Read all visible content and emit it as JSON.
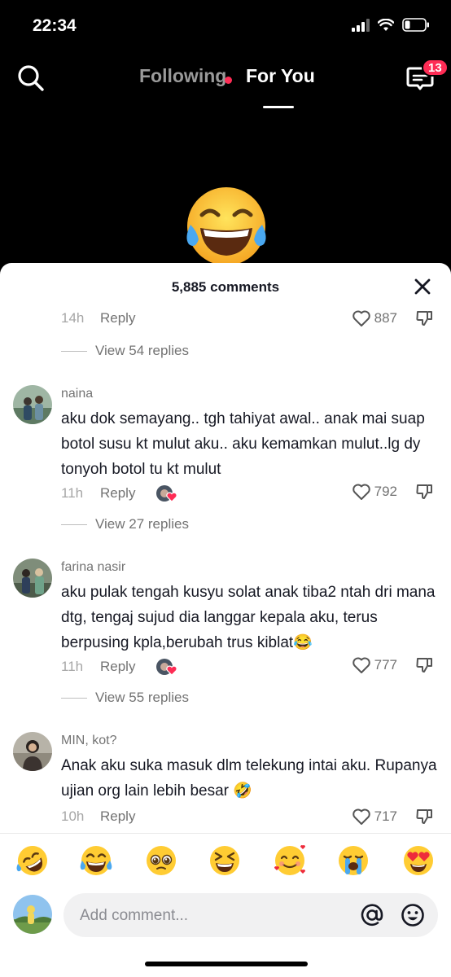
{
  "status_bar": {
    "time": "22:34"
  },
  "nav": {
    "tab_following": "Following",
    "tab_for_you": "For You",
    "inbox_badge": "13"
  },
  "comments_sheet": {
    "title": "5,885 comments",
    "comments": [
      {
        "username": "",
        "text": "",
        "time": "14h",
        "reply_label": "Reply",
        "likes": "887",
        "view_replies": "View 54 replies"
      },
      {
        "username": "naina",
        "text": "aku dok semayang.. tgh tahiyat awal.. anak mai suap botol susu kt mulut aku.. aku kemamkan mulut..lg dy tonyoh botol tu kt mulut",
        "time": "11h",
        "reply_label": "Reply",
        "likes": "792",
        "view_replies": "View 27 replies"
      },
      {
        "username": "farina nasir",
        "text": "aku pulak tengah kusyu solat anak tiba2 ntah dri mana dtg, tengaj sujud dia langgar kepala aku, terus berpusing kpla,berubah trus kiblat😂",
        "time": "11h",
        "reply_label": "Reply",
        "likes": "777",
        "view_replies": "View 55 replies"
      },
      {
        "username": "MIN, kot?",
        "text": "Anak aku suka masuk dlm telekung intai aku. Rupanya ujian org lain lebih besar 🤣",
        "time": "10h",
        "reply_label": "Reply",
        "likes": "717",
        "view_replies": ""
      }
    ],
    "quick_emojis": [
      "🤣",
      "😂",
      "🥺",
      "😆",
      "🥰",
      "😭",
      "😍"
    ],
    "input": {
      "placeholder": "Add comment..."
    }
  },
  "colors": {
    "accent": "#fe2c55",
    "muted": "#737373",
    "sheet_bg": "#ffffff"
  }
}
